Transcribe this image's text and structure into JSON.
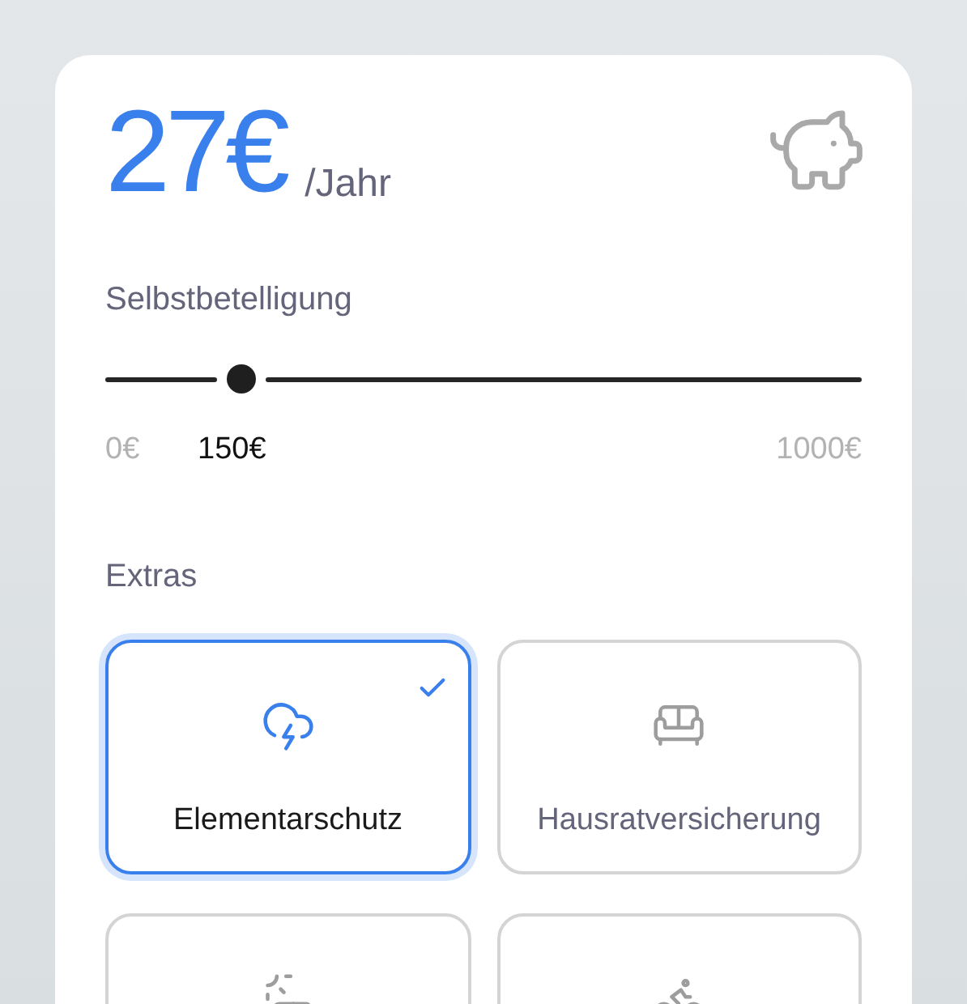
{
  "price": {
    "amount": "27€",
    "period": "/Jahr"
  },
  "deductible": {
    "label": "Selbstbetelligung",
    "level": 0.18,
    "min": "0€",
    "value": "150€",
    "max": "1000€"
  },
  "extras": {
    "label": "Extras",
    "items": [
      {
        "kind": "storm",
        "label": "Elementarschutz",
        "selected": true
      },
      {
        "kind": "sofa",
        "label": "Hausratversicherung",
        "selected": false
      },
      {
        "kind": "solar",
        "selected": false
      },
      {
        "kind": "bike",
        "selected": false
      }
    ]
  }
}
